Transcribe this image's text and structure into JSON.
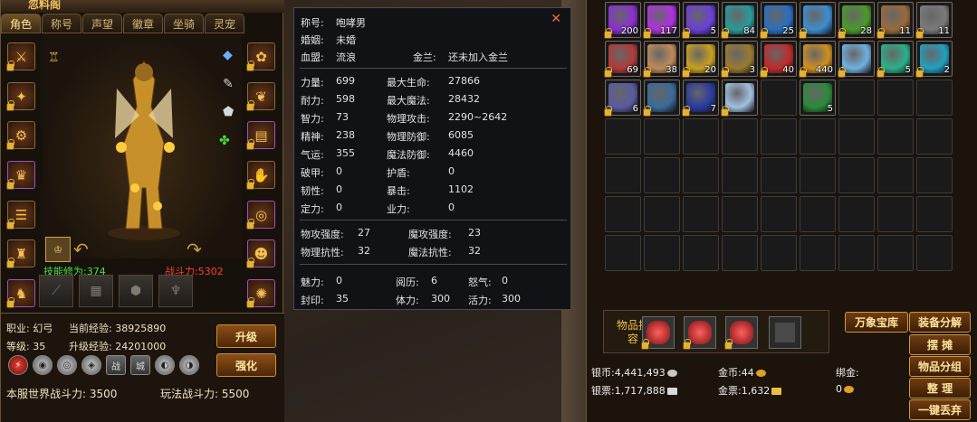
{
  "char_panel": {
    "title": "忽料阁",
    "tabs": [
      "角色",
      "称号",
      "声望",
      "徽章",
      "坐骑",
      "灵宠"
    ],
    "active_tab": "角色",
    "skill_label": "技能修为:374",
    "power_label": "战斗力:5302",
    "job": "职业: 幻弓",
    "current_exp": "当前经验: 38925890",
    "level": "等级: 35",
    "upgrade_exp": "升级经验: 24201000",
    "upgrade_btn": "升级",
    "enhance_btn": "强化",
    "world_power": "本服世界战斗力: 3500",
    "play_power": "玩法战斗力: 5500",
    "title_badges": [
      "战",
      "城"
    ]
  },
  "tooltip": {
    "name_label": "称号:",
    "name": "咆哮男",
    "marriage_label": "婚姻:",
    "marriage": "未婚",
    "alliance_label": "血盟:",
    "alliance": "流浪",
    "jinlan_label": "金兰:",
    "jinlan": "还未加入金兰",
    "close": "✕",
    "rows": [
      [
        "力量:",
        "699",
        "最大生命:",
        "27866"
      ],
      [
        "耐力:",
        "598",
        "最大魔法:",
        "28432"
      ],
      [
        "智力:",
        "73",
        "物理攻击:",
        "2290~2642"
      ],
      [
        "精神:",
        "238",
        "物理防御:",
        "6085"
      ],
      [
        "气运:",
        "355",
        "魔法防御:",
        "4460"
      ],
      [
        "破甲:",
        "0",
        "护盾:",
        "0"
      ],
      [
        "韧性:",
        "0",
        "暴击:",
        "1102"
      ],
      [
        "定力:",
        "0",
        "业力:",
        "0"
      ]
    ],
    "rows2": [
      [
        "物攻强度:",
        "27",
        "魔攻强度:",
        "23"
      ],
      [
        "物理抗性:",
        "32",
        "魔法抗性:",
        "32"
      ]
    ],
    "rows3": [
      [
        "魅力:",
        "0",
        "阅历:",
        "6",
        "怒气:",
        "0"
      ],
      [
        "封印:",
        "35",
        "体力:",
        "300",
        "活力:",
        "300"
      ]
    ]
  },
  "inventory": {
    "slots": [
      {
        "count": "200",
        "color": "#8a2fd0",
        "lock": true
      },
      {
        "count": "117",
        "color": "#b030e0",
        "lock": true
      },
      {
        "count": "5",
        "color": "#6a3fd8",
        "lock": true
      },
      {
        "count": "84",
        "color": "#2a9a9a",
        "lock": true
      },
      {
        "count": "25",
        "color": "#2a6ec0",
        "lock": true
      },
      {
        "count": "",
        "color": "#3c8ed0",
        "lock": true
      },
      {
        "count": "28",
        "color": "#4a9a2a",
        "lock": true
      },
      {
        "count": "11",
        "color": "#9a6a3a",
        "lock": true
      },
      {
        "count": "11",
        "color": "#7a7a7a",
        "lock": true
      },
      {
        "count": "69",
        "color": "#b03a3a",
        "lock": true
      },
      {
        "count": "38",
        "color": "#c08a5a",
        "lock": true
      },
      {
        "count": "20",
        "color": "#c8a020",
        "lock": true
      },
      {
        "count": "3",
        "color": "#9a7a30",
        "lock": true
      },
      {
        "count": "40",
        "color": "#c02a2a",
        "lock": true
      },
      {
        "count": "440",
        "color": "#d09020",
        "lock": true
      },
      {
        "count": "",
        "color": "#70b0e0",
        "lock": true
      },
      {
        "count": "5",
        "color": "#2ab08a",
        "lock": true
      },
      {
        "count": "2",
        "color": "#20a0c0",
        "lock": true
      },
      {
        "count": "6",
        "color": "#5a5aa0",
        "lock": true
      },
      {
        "count": "",
        "color": "#3a6a9a",
        "lock": true
      },
      {
        "count": "7",
        "color": "#2a3aa0",
        "lock": true
      },
      {
        "count": "",
        "color": "#a0c0e0",
        "lock": true
      },
      {
        "count": "",
        "color": "",
        "lock": false
      },
      {
        "count": "5",
        "color": "#2a8a3a",
        "lock": false
      }
    ],
    "total_cells": 63,
    "expand_label": "物品扩容",
    "btn_wanxiang": "万象宝库",
    "btn_decompose": "装备分解",
    "btn_stall": "摆 摊",
    "btn_group": "物品分组",
    "btn_sort": "整 理",
    "btn_discard": "一键丢弃",
    "silver_label": "银币:",
    "silver": "4,441,493",
    "gold_label": "金币:",
    "gold": "44",
    "bind_gold_label": "绑金:",
    "bind_gold": "0",
    "silver_ticket_label": "银票:",
    "silver_ticket": "1,717,888",
    "gold_ticket_label": "金票:",
    "gold_ticket": "1,632"
  }
}
